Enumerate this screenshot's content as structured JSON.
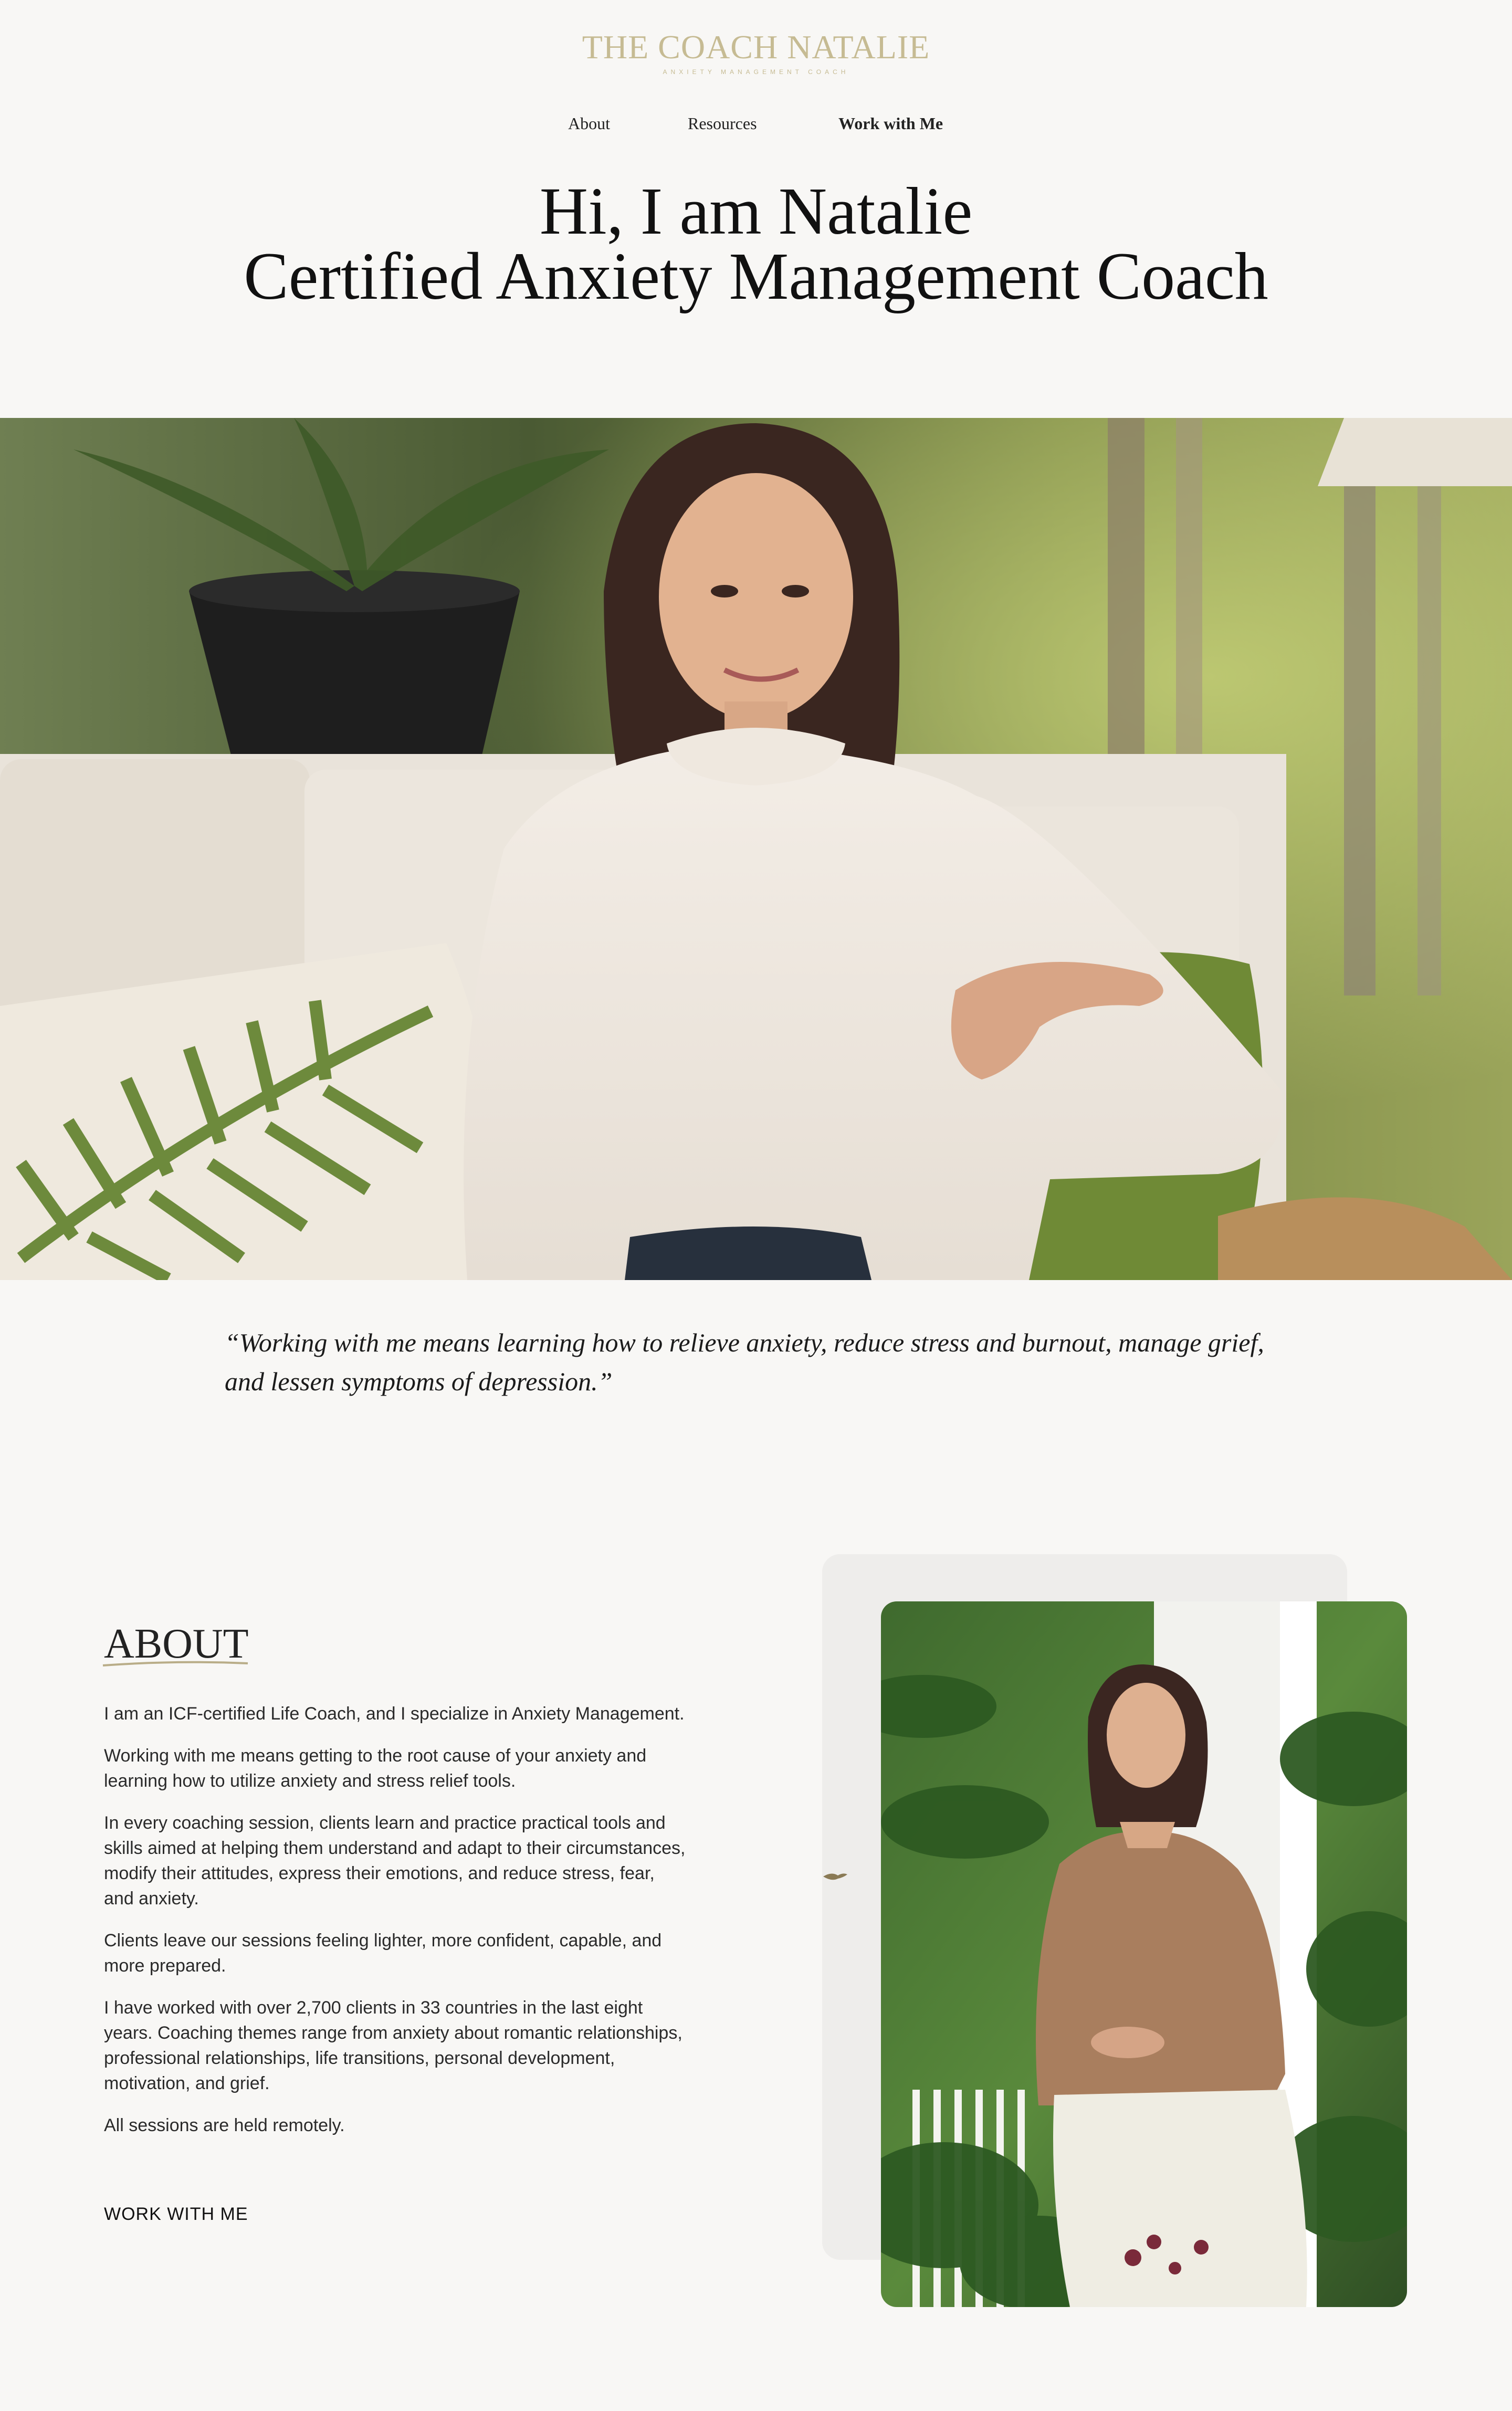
{
  "header": {
    "logo_light": "THE COACH",
    "logo_bold": "NATALIE",
    "logo_tagline": "ANXIETY MANAGEMENT COACH"
  },
  "nav": {
    "items": [
      "About",
      "Resources",
      "Work with Me"
    ]
  },
  "hero": {
    "line1": "Hi, I am Natalie",
    "line2": "Certified Anxiety Management Coach"
  },
  "quote": {
    "text": "“Working with me means learning how to relieve anxiety, reduce stress and burnout, manage grief, and lessen symptoms of depression.”"
  },
  "about": {
    "heading": "ABOUT",
    "paragraphs": [
      "I am an ICF-certified Life Coach, and I specialize in Anxiety Management.",
      "Working with me means getting to the root cause of your anxiety and learning how to utilize anxiety and stress relief tools.",
      "In every coaching session, clients learn and practice practical tools and skills aimed at helping them understand and adapt to their circumstances, modify their attitudes, express their emotions, and reduce stress, fear, and anxiety.",
      "Clients leave our sessions feeling lighter, more confident, capable, and more prepared.",
      "I have worked with over 2,700 clients in 33 countries in the last eight years. Coaching themes range from anxiety about romantic relationships, professional relationships, life transitions, personal development, motivation, and grief.",
      "All sessions are held remotely."
    ],
    "cta": "WORK WITH ME"
  },
  "colors": {
    "background": "#f8f7f5",
    "logo_gold": "#c6bb93",
    "text": "#1b1b1b"
  }
}
